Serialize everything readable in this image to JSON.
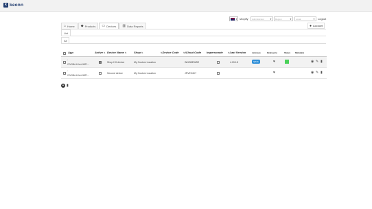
{
  "brand": {
    "logo_letter": "k",
    "name": "keonn"
  },
  "header": {
    "language_flag": "uk-flag",
    "shop_label": "shopify",
    "select_a_placeholder": "Administrator",
    "select_b_placeholder": "Region",
    "select_c_placeholder": "Local",
    "logout": "Logout"
  },
  "nav": {
    "tabs": [
      {
        "label": "Home",
        "icon": "home-icon"
      },
      {
        "label": "Products",
        "icon": "tag-icon"
      },
      {
        "label": "Devices",
        "icon": "monitor-icon",
        "active": true
      },
      {
        "label": "Data Reports",
        "icon": "bar-chart-icon"
      }
    ],
    "account": "Account"
  },
  "subtabs": {
    "list": "List",
    "all": "All"
  },
  "table": {
    "columns": {
      "app": "App",
      "active": "Active",
      "device_name": "Device Name",
      "shop": "Shop",
      "device_code": "Device Code",
      "icloud_code": "iCloud Code",
      "impersonate": "Impersonate",
      "last_version": "Last Version",
      "licenses": "Licenses",
      "relevance": "Relevance",
      "status": "Status",
      "metadata": "Metadata"
    },
    "rows": [
      {
        "app_name": "-",
        "app_id": "C0r35lu1UxmN8Fl...",
        "active": true,
        "device_name": "Shop HH device",
        "shop": "My Custom Location",
        "device_code": "",
        "icloud_code": "WNGBEW3R",
        "impersonate": false,
        "last_version": "4.15.18",
        "license": "hjfhkk",
        "status_color": "#4ad15a"
      },
      {
        "app_name": "-",
        "app_id": "C0r35lu1UxmN8Fl...",
        "active": false,
        "device_name": "Second device",
        "shop": "My Custom Location",
        "device_code": "",
        "icloud_code": "JRVE34K7",
        "impersonate": false,
        "last_version": "",
        "license": "",
        "status_color": ""
      }
    ]
  }
}
